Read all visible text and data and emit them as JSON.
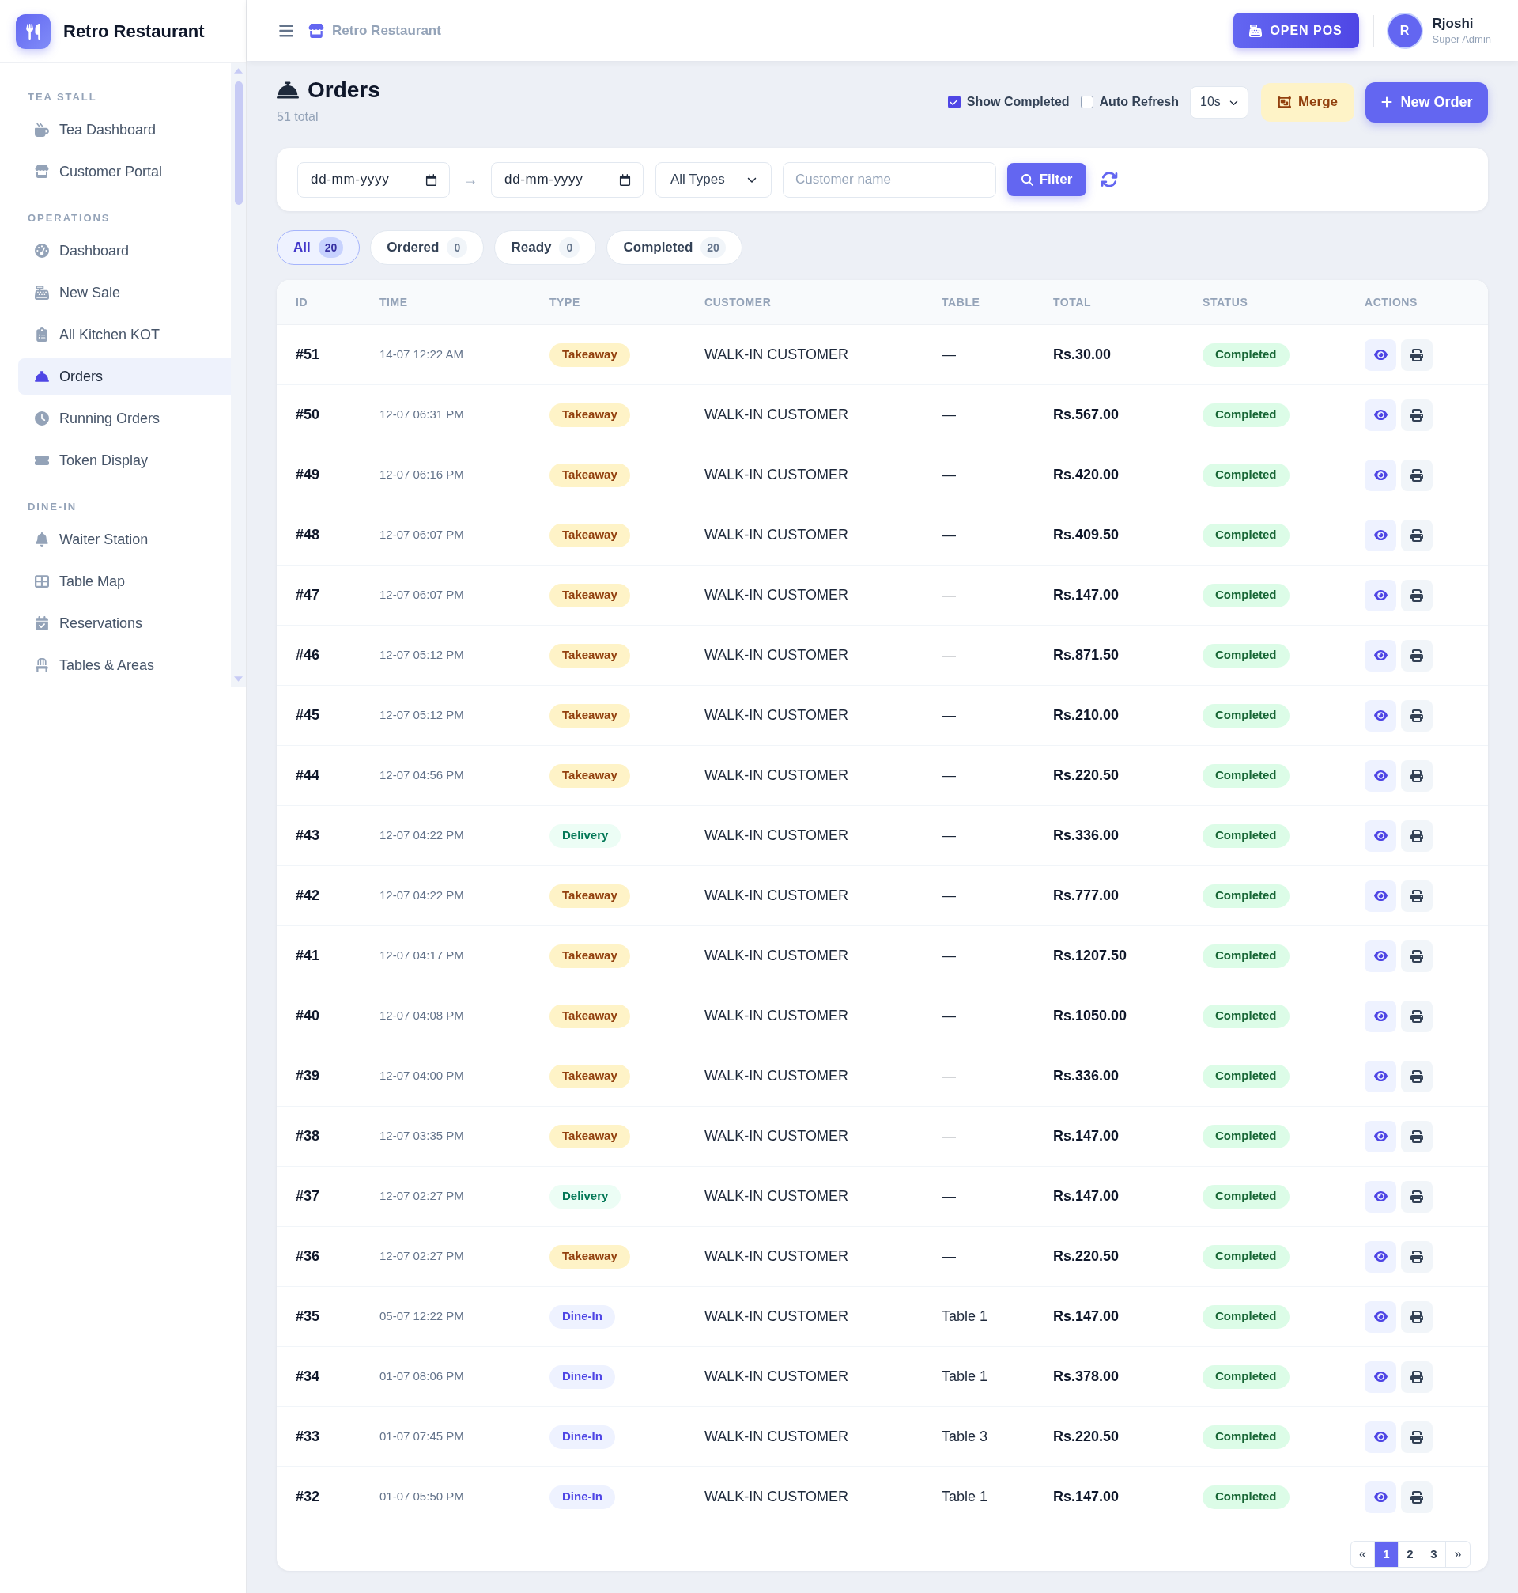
{
  "sidebar": {
    "brand": "Retro Restaurant",
    "sections": [
      {
        "title": "TEA STALL",
        "items": [
          {
            "label": "Tea Dashboard",
            "selected": false
          },
          {
            "label": "Customer Portal",
            "selected": false
          }
        ]
      },
      {
        "title": "OPERATIONS",
        "items": [
          {
            "label": "Dashboard",
            "selected": false
          },
          {
            "label": "New Sale",
            "selected": false
          },
          {
            "label": "All Kitchen KOT",
            "selected": false
          },
          {
            "label": "Orders",
            "selected": true
          },
          {
            "label": "Running Orders",
            "selected": false
          },
          {
            "label": "Token Display",
            "selected": false
          }
        ]
      },
      {
        "title": "DINE-IN",
        "items": [
          {
            "label": "Waiter Station",
            "selected": false
          },
          {
            "label": "Table Map",
            "selected": false
          },
          {
            "label": "Reservations",
            "selected": false
          },
          {
            "label": "Tables & Areas",
            "selected": false
          }
        ]
      }
    ]
  },
  "topbar": {
    "breadcrumb": "Retro Restaurant",
    "open_pos": "OPEN POS",
    "user": {
      "initial": "R",
      "name": "Rjoshi",
      "role": "Super Admin"
    }
  },
  "page": {
    "title": "Orders",
    "subtitle": "51 total",
    "toggles": [
      {
        "label": "Show Completed",
        "checked": true
      },
      {
        "label": "Auto Refresh",
        "checked": false
      }
    ],
    "refresh_interval": "10s",
    "merge_button": "Merge",
    "new_order_button": "New Order"
  },
  "filters": {
    "date_from": {
      "placeholder": "dd-mm-yyyy"
    },
    "separator": "→",
    "date_to": {
      "placeholder": "dd-mm-yyyy"
    },
    "type_select": "All Types",
    "customer": {
      "placeholder": "Customer name"
    },
    "filter_button": "Filter"
  },
  "status_tabs": [
    {
      "label": "All",
      "count": "20",
      "selected": true
    },
    {
      "label": "Ordered",
      "count": "0",
      "selected": false
    },
    {
      "label": "Ready",
      "count": "0",
      "selected": false
    },
    {
      "label": "Completed",
      "count": "20",
      "selected": false
    }
  ],
  "table": {
    "columns": [
      "ID",
      "TIME",
      "TYPE",
      "CUSTOMER",
      "TABLE",
      "TOTAL",
      "STATUS",
      "ACTIONS"
    ],
    "rows": [
      {
        "id": "#51",
        "time": "14-07 12:22 AM",
        "type": {
          "label": "Takeaway",
          "kind": "takeaway"
        },
        "customer": "WALK-IN CUSTOMER",
        "table": "—",
        "total": "Rs.30.00",
        "status": {
          "label": "Completed",
          "kind": "completed"
        }
      },
      {
        "id": "#50",
        "time": "12-07 06:31 PM",
        "type": {
          "label": "Takeaway",
          "kind": "takeaway"
        },
        "customer": "WALK-IN CUSTOMER",
        "table": "—",
        "total": "Rs.567.00",
        "status": {
          "label": "Completed",
          "kind": "completed"
        }
      },
      {
        "id": "#49",
        "time": "12-07 06:16 PM",
        "type": {
          "label": "Takeaway",
          "kind": "takeaway"
        },
        "customer": "WALK-IN CUSTOMER",
        "table": "—",
        "total": "Rs.420.00",
        "status": {
          "label": "Completed",
          "kind": "completed"
        }
      },
      {
        "id": "#48",
        "time": "12-07 06:07 PM",
        "type": {
          "label": "Takeaway",
          "kind": "takeaway"
        },
        "customer": "WALK-IN CUSTOMER",
        "table": "—",
        "total": "Rs.409.50",
        "status": {
          "label": "Completed",
          "kind": "completed"
        }
      },
      {
        "id": "#47",
        "time": "12-07 06:07 PM",
        "type": {
          "label": "Takeaway",
          "kind": "takeaway"
        },
        "customer": "WALK-IN CUSTOMER",
        "table": "—",
        "total": "Rs.147.00",
        "status": {
          "label": "Completed",
          "kind": "completed"
        }
      },
      {
        "id": "#46",
        "time": "12-07 05:12 PM",
        "type": {
          "label": "Takeaway",
          "kind": "takeaway"
        },
        "customer": "WALK-IN CUSTOMER",
        "table": "—",
        "total": "Rs.871.50",
        "status": {
          "label": "Completed",
          "kind": "completed"
        }
      },
      {
        "id": "#45",
        "time": "12-07 05:12 PM",
        "type": {
          "label": "Takeaway",
          "kind": "takeaway"
        },
        "customer": "WALK-IN CUSTOMER",
        "table": "—",
        "total": "Rs.210.00",
        "status": {
          "label": "Completed",
          "kind": "completed"
        }
      },
      {
        "id": "#44",
        "time": "12-07 04:56 PM",
        "type": {
          "label": "Takeaway",
          "kind": "takeaway"
        },
        "customer": "WALK-IN CUSTOMER",
        "table": "—",
        "total": "Rs.220.50",
        "status": {
          "label": "Completed",
          "kind": "completed"
        }
      },
      {
        "id": "#43",
        "time": "12-07 04:22 PM",
        "type": {
          "label": "Delivery",
          "kind": "delivery"
        },
        "customer": "WALK-IN CUSTOMER",
        "table": "—",
        "total": "Rs.336.00",
        "status": {
          "label": "Completed",
          "kind": "completed"
        }
      },
      {
        "id": "#42",
        "time": "12-07 04:22 PM",
        "type": {
          "label": "Takeaway",
          "kind": "takeaway"
        },
        "customer": "WALK-IN CUSTOMER",
        "table": "—",
        "total": "Rs.777.00",
        "status": {
          "label": "Completed",
          "kind": "completed"
        }
      },
      {
        "id": "#41",
        "time": "12-07 04:17 PM",
        "type": {
          "label": "Takeaway",
          "kind": "takeaway"
        },
        "customer": "WALK-IN CUSTOMER",
        "table": "—",
        "total": "Rs.1207.50",
        "status": {
          "label": "Completed",
          "kind": "completed"
        }
      },
      {
        "id": "#40",
        "time": "12-07 04:08 PM",
        "type": {
          "label": "Takeaway",
          "kind": "takeaway"
        },
        "customer": "WALK-IN CUSTOMER",
        "table": "—",
        "total": "Rs.1050.00",
        "status": {
          "label": "Completed",
          "kind": "completed"
        }
      },
      {
        "id": "#39",
        "time": "12-07 04:00 PM",
        "type": {
          "label": "Takeaway",
          "kind": "takeaway"
        },
        "customer": "WALK-IN CUSTOMER",
        "table": "—",
        "total": "Rs.336.00",
        "status": {
          "label": "Completed",
          "kind": "completed"
        }
      },
      {
        "id": "#38",
        "time": "12-07 03:35 PM",
        "type": {
          "label": "Takeaway",
          "kind": "takeaway"
        },
        "customer": "WALK-IN CUSTOMER",
        "table": "—",
        "total": "Rs.147.00",
        "status": {
          "label": "Completed",
          "kind": "completed"
        }
      },
      {
        "id": "#37",
        "time": "12-07 02:27 PM",
        "type": {
          "label": "Delivery",
          "kind": "delivery"
        },
        "customer": "WALK-IN CUSTOMER",
        "table": "—",
        "total": "Rs.147.00",
        "status": {
          "label": "Completed",
          "kind": "completed"
        }
      },
      {
        "id": "#36",
        "time": "12-07 02:27 PM",
        "type": {
          "label": "Takeaway",
          "kind": "takeaway"
        },
        "customer": "WALK-IN CUSTOMER",
        "table": "—",
        "total": "Rs.220.50",
        "status": {
          "label": "Completed",
          "kind": "completed"
        }
      },
      {
        "id": "#35",
        "time": "05-07 12:22 PM",
        "type": {
          "label": "Dine-In",
          "kind": "dinein"
        },
        "customer": "WALK-IN CUSTOMER",
        "table": "Table 1",
        "total": "Rs.147.00",
        "status": {
          "label": "Completed",
          "kind": "completed"
        }
      },
      {
        "id": "#34",
        "time": "01-07 08:06 PM",
        "type": {
          "label": "Dine-In",
          "kind": "dinein"
        },
        "customer": "WALK-IN CUSTOMER",
        "table": "Table 1",
        "total": "Rs.378.00",
        "status": {
          "label": "Completed",
          "kind": "completed"
        }
      },
      {
        "id": "#33",
        "time": "01-07 07:45 PM",
        "type": {
          "label": "Dine-In",
          "kind": "dinein"
        },
        "customer": "WALK-IN CUSTOMER",
        "table": "Table 3",
        "total": "Rs.220.50",
        "status": {
          "label": "Completed",
          "kind": "completed"
        }
      },
      {
        "id": "#32",
        "time": "01-07 05:50 PM",
        "type": {
          "label": "Dine-In",
          "kind": "dinein"
        },
        "customer": "WALK-IN CUSTOMER",
        "table": "Table 1",
        "total": "Rs.147.00",
        "status": {
          "label": "Completed",
          "kind": "completed"
        }
      }
    ]
  },
  "pagination": {
    "prev": "«",
    "pages": [
      {
        "label": "1",
        "selected": true
      },
      {
        "label": "2",
        "selected": false
      },
      {
        "label": "3",
        "selected": false
      }
    ],
    "next": "»"
  }
}
